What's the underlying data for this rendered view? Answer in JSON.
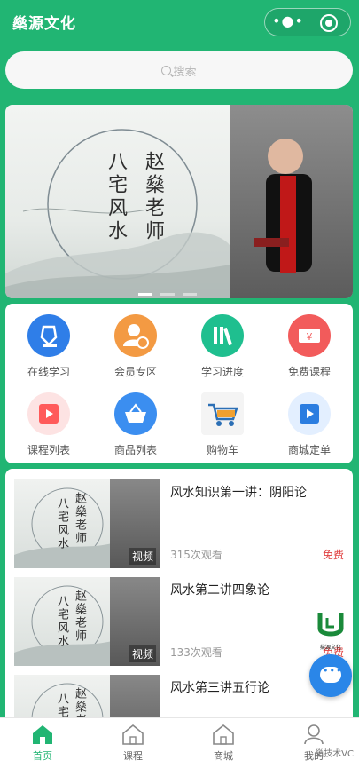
{
  "header": {
    "title": "燊源文化",
    "menu_icon": "more-dots-icon",
    "close_icon": "target-icon"
  },
  "search": {
    "placeholder": "搜索"
  },
  "banner": {
    "title_left": "八宅风水",
    "title_right": "赵燊老师"
  },
  "grid": [
    {
      "label": "在线学习",
      "icon": "pen-nib-icon",
      "color": "#2f7ee8"
    },
    {
      "label": "会员专区",
      "icon": "member-icon",
      "color": "#f39a43"
    },
    {
      "label": "学习进度",
      "icon": "books-icon",
      "color": "#1fbf8f"
    },
    {
      "label": "免费课程",
      "icon": "coupon-icon",
      "color": "#f25b5b"
    },
    {
      "label": "课程列表",
      "icon": "video-play-icon",
      "color": "#ff5a5a"
    },
    {
      "label": "商品列表",
      "icon": "basket-icon",
      "color": "#3b8ef0"
    },
    {
      "label": "购物车",
      "icon": "cart-icon",
      "color": "#f0a030"
    },
    {
      "label": "商城定单",
      "icon": "play-square-icon",
      "color": "#2b7de0"
    }
  ],
  "courses": [
    {
      "title": "风水知识第一讲：阴阳论",
      "views": "315次观看",
      "price": "免费",
      "tag": "视频",
      "thumb_left": "八宅风水",
      "thumb_right": "赵燊老师"
    },
    {
      "title": "风水第二讲四象论",
      "views": "133次观看",
      "price": "免费",
      "tag": "视频",
      "thumb_left": "八宅风水",
      "thumb_right": "赵燊老师"
    },
    {
      "title": "风水第三讲五行论",
      "views": "",
      "price": "",
      "tag": "",
      "thumb_left": "八宅",
      "thumb_right": "赵燊老"
    }
  ],
  "tabbar": [
    {
      "label": "首页",
      "icon": "home-icon",
      "active": true
    },
    {
      "label": "课程",
      "icon": "home-icon",
      "active": false
    },
    {
      "label": "商城",
      "icon": "home-icon",
      "active": false
    },
    {
      "label": "我的",
      "icon": "user-icon",
      "active": false
    }
  ],
  "colors": {
    "primary": "#21b573",
    "free": "#e04040",
    "fab": "#2a86e8"
  },
  "watermark": "燊技术VC",
  "logo_caption": "燊源文化"
}
